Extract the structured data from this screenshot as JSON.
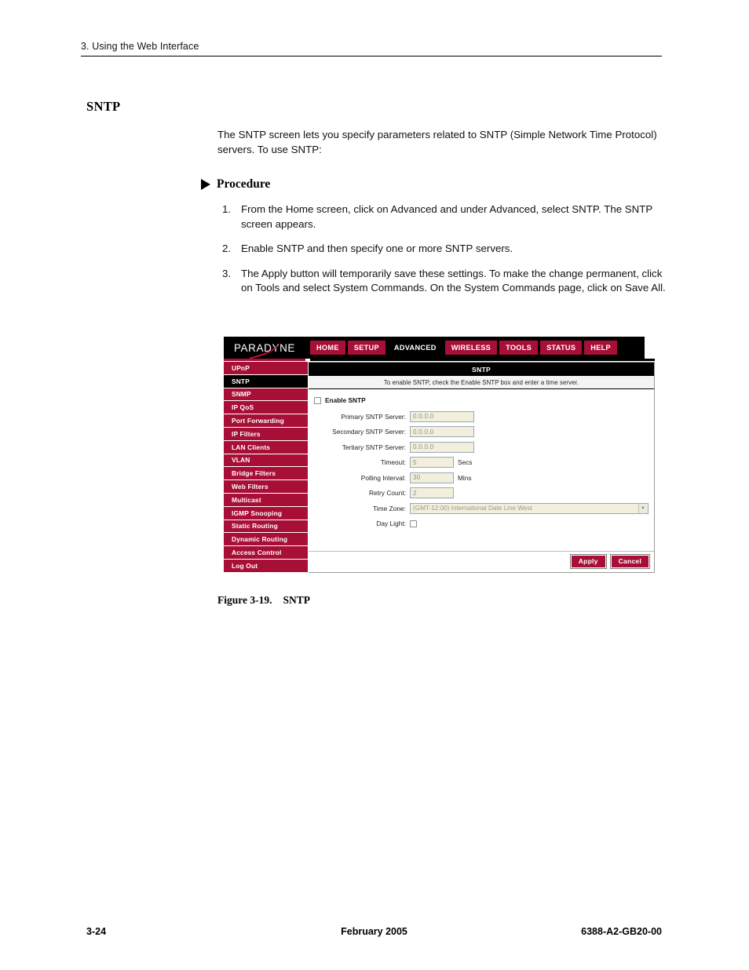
{
  "page_header": {
    "chapter": "3. Using the Web Interface"
  },
  "section": {
    "title": "SNTP",
    "intro": "The SNTP screen lets you specify parameters related to SNTP (Simple Network Time Protocol) servers. To use SNTP:",
    "procedure_label": "Procedure"
  },
  "steps": [
    {
      "num": "1.",
      "text": "From the Home screen, click on Advanced and under Advanced, select SNTP. The SNTP screen appears."
    },
    {
      "num": "2.",
      "text": "Enable SNTP and then specify one or more SNTP servers."
    },
    {
      "num": "3.",
      "text": "The Apply button will temporarily save these settings. To make the change permanent, click on Tools and select System Commands. On the System Commands page, click on Save All."
    }
  ],
  "screenshot": {
    "logo": "PARADYNE",
    "nav_tabs": [
      {
        "label": "HOME",
        "active": false
      },
      {
        "label": "SETUP",
        "active": false
      },
      {
        "label": "ADVANCED",
        "active": true
      },
      {
        "label": "WIRELESS",
        "active": false
      },
      {
        "label": "TOOLS",
        "active": false
      },
      {
        "label": "STATUS",
        "active": false
      },
      {
        "label": "HELP",
        "active": false
      }
    ],
    "sidebar": [
      {
        "label": "UPnP",
        "active": false
      },
      {
        "label": "SNTP",
        "active": true
      },
      {
        "label": "SNMP",
        "active": false
      },
      {
        "label": "IP QoS",
        "active": false
      },
      {
        "label": "Port Forwarding",
        "active": false
      },
      {
        "label": "IP Filters",
        "active": false
      },
      {
        "label": "LAN Clients",
        "active": false
      },
      {
        "label": "VLAN",
        "active": false
      },
      {
        "label": "Bridge Filters",
        "active": false
      },
      {
        "label": "Web Filters",
        "active": false
      },
      {
        "label": "Multicast",
        "active": false
      },
      {
        "label": "IGMP Snooping",
        "active": false
      },
      {
        "label": "Static Routing",
        "active": false
      },
      {
        "label": "Dynamic Routing",
        "active": false
      },
      {
        "label": "Access Control",
        "active": false
      },
      {
        "label": "Log Out",
        "active": false
      }
    ],
    "panel": {
      "title": "SNTP",
      "description": "To enable SNTP, check the Enable SNTP box and enter a time server."
    },
    "form": {
      "enable_label": "Enable SNTP",
      "enable_checked": false,
      "fields": [
        {
          "label": "Primary SNTP Server:",
          "value": "0.0.0.0",
          "unit": ""
        },
        {
          "label": "Secondary SNTP Server:",
          "value": "0.0.0.0",
          "unit": ""
        },
        {
          "label": "Tertiary SNTP Server:",
          "value": "0.0.0.0",
          "unit": ""
        },
        {
          "label": "Timeout:",
          "value": "5",
          "unit": "Secs"
        },
        {
          "label": "Polling Interval:",
          "value": "30",
          "unit": "Mins"
        },
        {
          "label": "Retry Count:",
          "value": "2",
          "unit": ""
        }
      ],
      "timezone_label": "Time Zone:",
      "timezone_value": "(GMT-12:00) International Date Line West",
      "daylight_label": "Day Light:",
      "daylight_checked": false
    },
    "buttons": {
      "apply": "Apply",
      "cancel": "Cancel"
    },
    "colors": {
      "brand_crimson": "#a80f36",
      "active_black": "#000000",
      "field_background": "#f2f0dc"
    }
  },
  "figure_caption": {
    "number": "Figure 3-19.",
    "title": "SNTP"
  },
  "page_footer": {
    "page_number": "3-24",
    "date": "February 2005",
    "doc_number": "6388-A2-GB20-00"
  }
}
